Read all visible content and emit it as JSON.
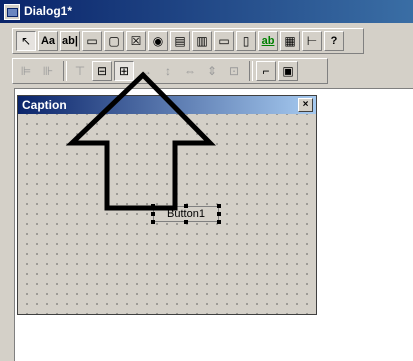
{
  "window": {
    "title": "Dialog1*"
  },
  "toolbar1": {
    "buttons": [
      {
        "icon": "pointer-icon",
        "glyph": "↖"
      },
      {
        "icon": "static-text-icon",
        "glyph": "Aa"
      },
      {
        "icon": "edit-control-icon",
        "glyph": "ab|"
      },
      {
        "icon": "group-box-icon",
        "glyph": "▭"
      },
      {
        "icon": "button-control-icon",
        "glyph": "▢"
      },
      {
        "icon": "check-box-icon",
        "glyph": "☒"
      },
      {
        "icon": "radio-button-icon",
        "glyph": "◉"
      },
      {
        "icon": "combo-box-icon",
        "glyph": "▤"
      },
      {
        "icon": "list-box-icon",
        "glyph": "▥"
      },
      {
        "icon": "horizontal-scrollbar-icon",
        "glyph": "▭"
      },
      {
        "icon": "vertical-scrollbar-icon",
        "glyph": "▯"
      },
      {
        "icon": "spin-control-icon",
        "glyph": "ab"
      },
      {
        "icon": "list-control-icon",
        "glyph": "▦"
      },
      {
        "icon": "tree-control-icon",
        "glyph": "⊢"
      },
      {
        "icon": "help-icon",
        "glyph": "?"
      }
    ]
  },
  "toolbar2": {
    "buttons": [
      {
        "icon": "align-left-icon",
        "glyph": "⊫"
      },
      {
        "icon": "align-right-icon",
        "glyph": "⊪"
      },
      {
        "icon": "align-top-icon",
        "glyph": "⊤"
      },
      {
        "icon": "center-vertical-icon",
        "glyph": "⊟"
      },
      {
        "icon": "center-horizontal-icon",
        "glyph": "⊞"
      },
      {
        "icon": "space-across-icon",
        "glyph": "↔"
      },
      {
        "icon": "space-down-icon",
        "glyph": "↕"
      },
      {
        "icon": "same-width-icon",
        "glyph": "⇔"
      },
      {
        "icon": "same-height-icon",
        "glyph": "⇕"
      },
      {
        "icon": "same-size-icon",
        "glyph": "⊡"
      },
      {
        "icon": "tab-order-icon",
        "glyph": "⌐"
      },
      {
        "icon": "test-dialog-icon",
        "glyph": "▣"
      }
    ]
  },
  "dialog": {
    "caption": "Caption",
    "close_glyph": "×",
    "button_label": "Button1"
  }
}
